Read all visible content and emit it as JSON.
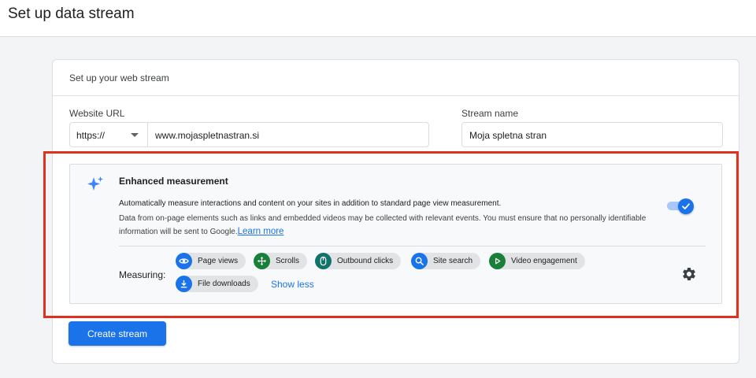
{
  "header": {
    "title": "Set up data stream"
  },
  "card": {
    "title": "Set up your web stream"
  },
  "website": {
    "label": "Website URL",
    "protocol": "https://",
    "url": "www.mojaspletnastran.si"
  },
  "stream": {
    "label": "Stream name",
    "value": "Moja spletna stran"
  },
  "enhanced": {
    "title": "Enhanced measurement",
    "icon": "sparkle-icon",
    "description": "Automatically measure interactions and content on your sites in addition to standard page view measurement.",
    "note": "Data from on-page elements such as links and embedded videos may be collected with relevant events. You must ensure that no personally identifiable information will be sent to Google.",
    "learn_more": "Learn more",
    "toggle_on": true,
    "measuring_label": "Measuring:",
    "chips": [
      {
        "label": "Page views",
        "icon": "eye-icon",
        "color": "#1a73e8"
      },
      {
        "label": "Scrolls",
        "icon": "move-arrows-icon",
        "color": "#188038"
      },
      {
        "label": "Outbound clicks",
        "icon": "mouse-icon",
        "color": "#12736a"
      },
      {
        "label": "Site search",
        "icon": "search-icon",
        "color": "#1a73e8"
      },
      {
        "label": "Video engagement",
        "icon": "play-icon",
        "color": "#188038"
      },
      {
        "label": "File downloads",
        "icon": "download-icon",
        "color": "#1a73e8"
      }
    ],
    "show_less": "Show less",
    "settings_icon": "gear-icon"
  },
  "actions": {
    "create": "Create stream"
  },
  "colors": {
    "accent": "#1a73e8",
    "highlight": "#e0301e",
    "green": "#188038",
    "teal": "#12736a"
  }
}
